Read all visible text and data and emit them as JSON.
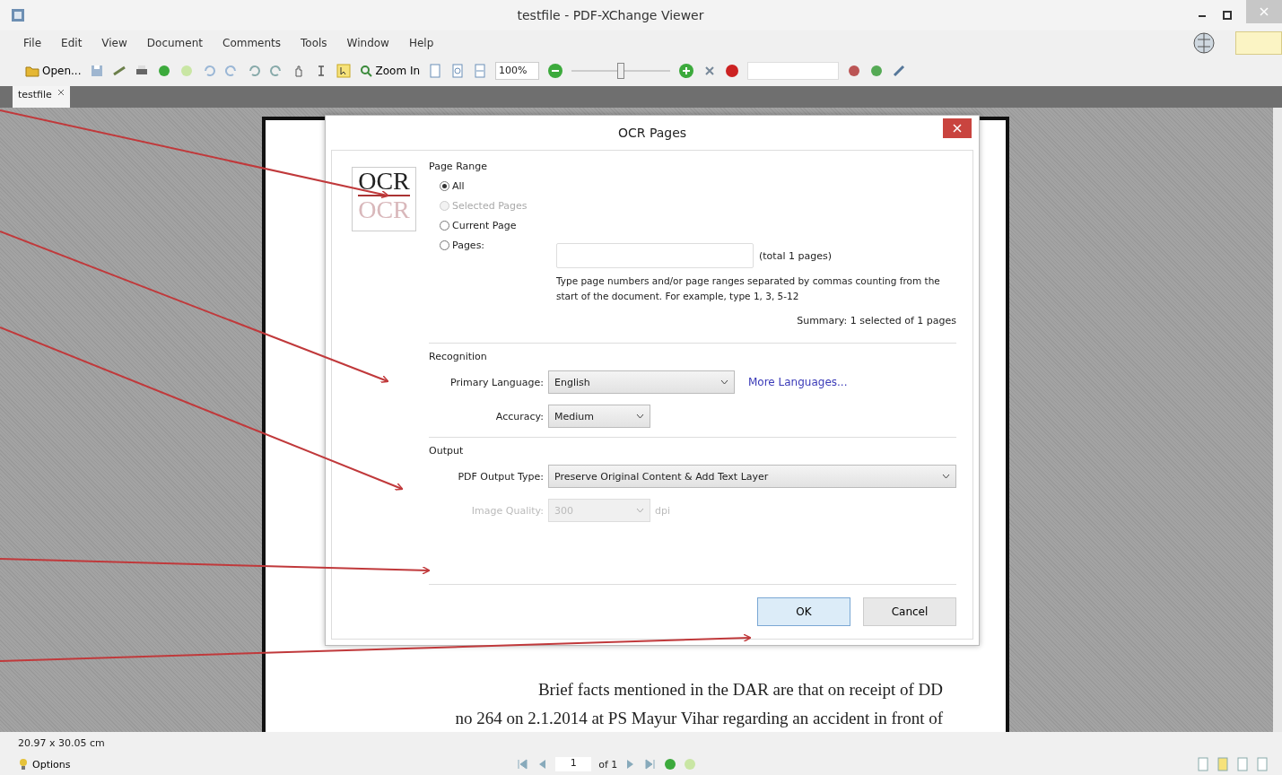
{
  "window": {
    "title": "testfile - PDF-XChange Viewer"
  },
  "menu": [
    "File",
    "Edit",
    "View",
    "Document",
    "Comments",
    "Tools",
    "Window",
    "Help"
  ],
  "toolbar": {
    "open_label": "Open...",
    "zoom_in_label": "Zoom In",
    "zoom_value": "100%",
    "zoom": {
      "level": 0.5
    }
  },
  "tabs": [
    {
      "label": "testfile",
      "selected": true
    }
  ],
  "document": {
    "lines": [
      "Brief facts mentioned in the DAR are that on receipt of DD",
      "no 264 on 2.1.2014 at PS Mayur Vihar regarding an accident in front of"
    ]
  },
  "dialog": {
    "title": "OCR Pages",
    "logo_text": "OCR",
    "logo_reflection": "OCR",
    "page_range": {
      "title": "Page Range",
      "options": [
        {
          "label": "All",
          "selected": true,
          "disabled": false
        },
        {
          "label": "Selected Pages",
          "selected": false,
          "disabled": true
        },
        {
          "label": "Current Page",
          "selected": false,
          "disabled": false
        },
        {
          "label": "Pages:",
          "selected": false,
          "disabled": false
        }
      ],
      "total": "(total 1 pages)",
      "hint": "Type page numbers and/or page ranges separated by commas counting from the start of the document. For example, type 1, 3, 5-12",
      "summary": "Summary: 1 selected of 1 pages"
    },
    "recognition": {
      "title": "Recognition",
      "language_label": "Primary Language:",
      "language": "English",
      "more_link": "More Languages...",
      "accuracy_label": "Accuracy:",
      "accuracy": "Medium"
    },
    "output": {
      "title": "Output",
      "type_label": "PDF Output Type:",
      "type": "Preserve Original Content & Add Text Layer",
      "quality_label": "Image Quality:",
      "quality": "300",
      "quality_unit": "dpi",
      "quality_disabled": true
    },
    "buttons": [
      {
        "label": "OK",
        "default": true
      },
      {
        "label": "Cancel",
        "default": false
      }
    ]
  },
  "status_bar": {
    "page_size": "20.97 x 30.05 cm",
    "options": "Options",
    "page": "1",
    "page_total": "of 1"
  }
}
